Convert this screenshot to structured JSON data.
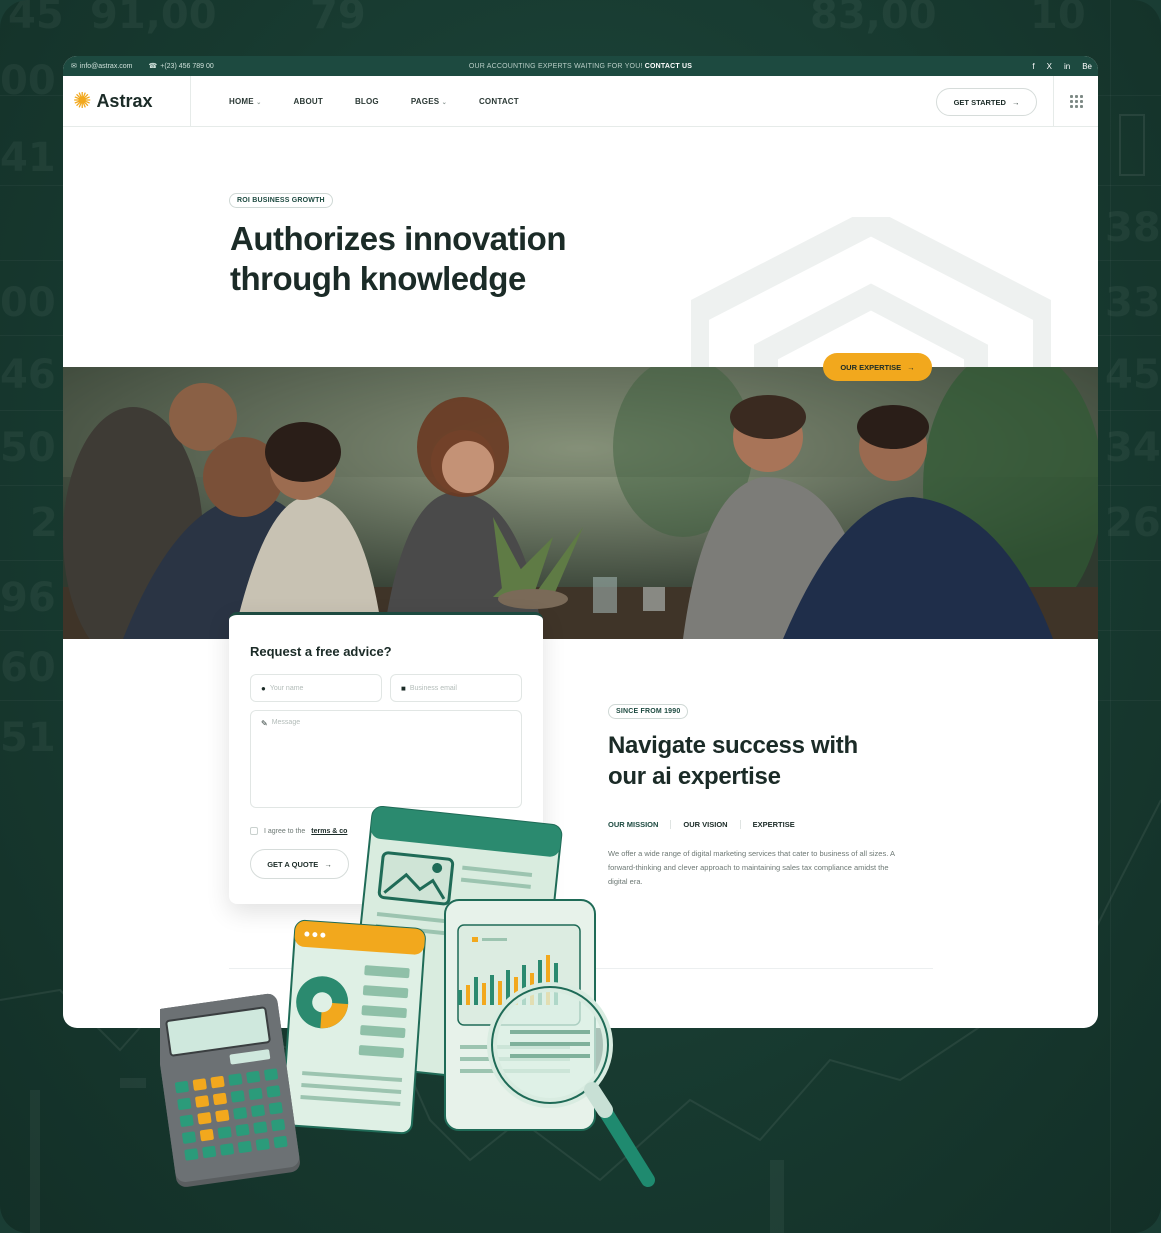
{
  "topbar": {
    "email": "info@astrax.com",
    "phone": "+(23) 456 789 00",
    "announcement": "OUR ACCOUNTING EXPERTS WAITING FOR YOU!",
    "announcement_link": "CONTACT US",
    "social": [
      "f",
      "X",
      "in",
      "Be"
    ]
  },
  "nav": {
    "logo_text": "Astrax",
    "items": [
      {
        "label": "HOME",
        "has_caret": true
      },
      {
        "label": "ABOUT",
        "has_caret": false
      },
      {
        "label": "BLOG",
        "has_caret": false
      },
      {
        "label": "PAGES",
        "has_caret": true
      },
      {
        "label": "CONTACT",
        "has_caret": false
      }
    ],
    "cta_label": "GET STARTED"
  },
  "hero": {
    "tag": "ROI BUSINESS GROWTH",
    "title_line1": "Authorizes innovation",
    "title_line2": "through knowledge",
    "expertise_button": "OUR EXPERTISE"
  },
  "form": {
    "title": "Request a free advice?",
    "name_placeholder": "Your name",
    "email_placeholder": "Business email",
    "message_placeholder": "Message",
    "agree_text": "I agree to the",
    "agree_link": "terms & co",
    "submit_label": "GET A QUOTE"
  },
  "about": {
    "tag": "SINCE FROM 1990",
    "title_line1": "Navigate success with",
    "title_line2": "our ai expertise",
    "tabs": [
      "OUR MISSION",
      "OUR VISION",
      "EXPERTISE"
    ],
    "description": "We offer a wide range of digital marketing services that cater to business of all sizes. A forward-thinking and clever approach to maintaining sales tax compliance amidst the digital era."
  },
  "background_numbers": [
    "45",
    "91,00",
    "79",
    "83,00",
    "10",
    "00",
    "41",
    "38",
    "00",
    "33",
    "46",
    "45",
    "50",
    "34",
    "2",
    "26",
    "96",
    "60",
    "51"
  ],
  "colors": {
    "brand_dark": "#1d4a40",
    "accent": "#f2a81d",
    "text": "#1b2b27"
  }
}
